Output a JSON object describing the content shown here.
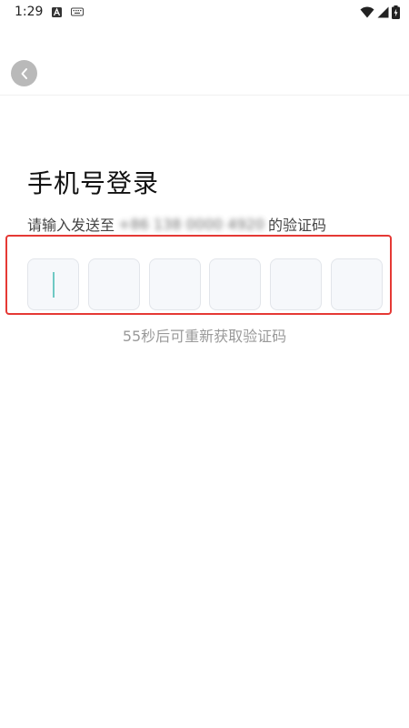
{
  "status_bar": {
    "time": "1:29",
    "icons": [
      "a-badge-icon",
      "keyboard-icon",
      "wifi-icon",
      "signal-icon",
      "battery-charging-icon"
    ]
  },
  "header": {
    "back_icon": "chevron-left-icon"
  },
  "login": {
    "title": "手机号登录",
    "subtitle_prefix": "请输入发送至",
    "phone_number": "+86 138 0000 4920",
    "subtitle_suffix": "的验证码"
  },
  "code_inputs": {
    "count": 6,
    "values": [
      "",
      "",
      "",
      "",
      "",
      ""
    ],
    "active_index": 0
  },
  "resend": {
    "text": "55秒后可重新获取验证码"
  },
  "colors": {
    "highlight": "#e53935",
    "cursor": "#6fc9c4",
    "back_button": "#b9b9b9",
    "input_bg": "#f6f8fb"
  }
}
